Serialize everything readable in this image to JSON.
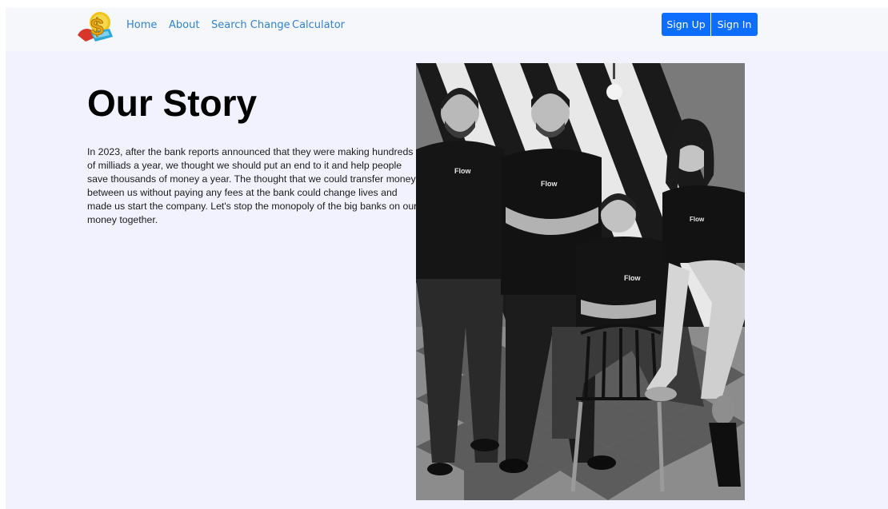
{
  "nav": {
    "logo_name": "dollar-logo-icon",
    "links": [
      "Home",
      "About",
      "Search Change",
      "Calculator"
    ],
    "sign_up": "Sign Up",
    "sign_in": "Sign In"
  },
  "main": {
    "title": "Our Story",
    "paragraph": "In 2023, after the bank reports announced that they were making hundreds of milliads a year, we thought we should put an end to it and help people save thousands of money a year. The thought that we could transfer money between us without paying any fees at the bank could change lives and made us start the company. Let's stop the monopoly of the big banks on our money together.",
    "photo": {
      "shirt_text": "Flow"
    }
  },
  "colors": {
    "page_bg": "#f1f2fd",
    "nav_bg": "#f6f7fa",
    "link": "#2f83d4",
    "button": "#0d6efd"
  }
}
